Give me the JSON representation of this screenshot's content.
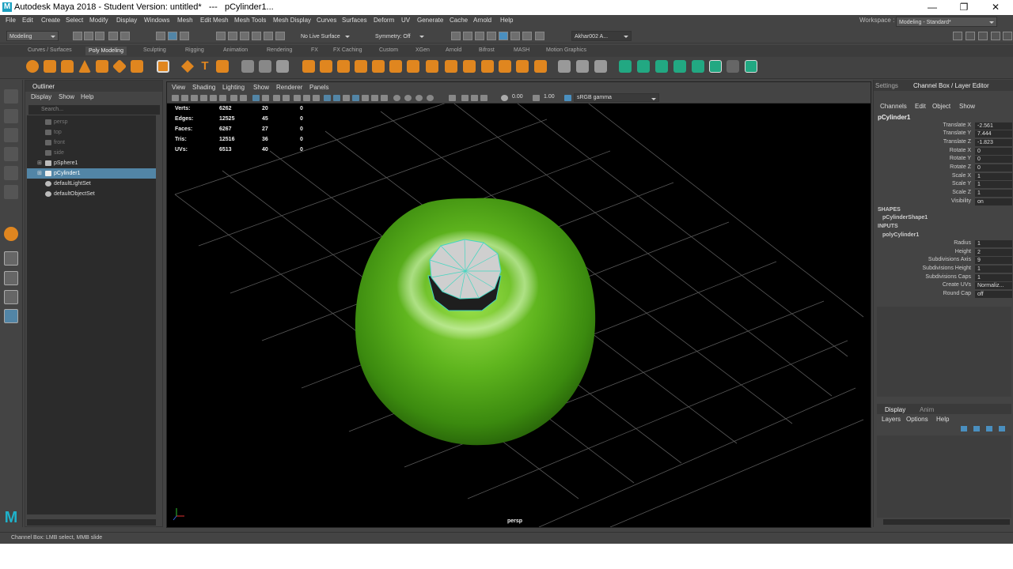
{
  "title_bar": {
    "title": "Autodesk Maya 2018 - Student Version: untitled*   ---   pCylinder1...",
    "minimize": "—",
    "maximize": "❐",
    "close": "✕"
  },
  "menu": [
    "File",
    "Edit",
    "Create",
    "Select",
    "Modify",
    "Display",
    "Windows",
    "Mesh",
    "Edit Mesh",
    "Mesh Tools",
    "Mesh Display",
    "Curves",
    "Surfaces",
    "Deform",
    "UV",
    "Generate",
    "Cache",
    "Arnold",
    "Help"
  ],
  "workspace": {
    "label": "Workspace :",
    "value": "Modeling - Standard*"
  },
  "status_line": {
    "mode": "Modeling",
    "live_surface": "No Live Surface",
    "symmetry": "Symmetry: Off",
    "user": "Akhar002 A..."
  },
  "shelf_tabs": [
    "Curves / Surfaces",
    "Poly Modeling",
    "Sculpting",
    "Rigging",
    "Animation",
    "Rendering",
    "FX",
    "FX Caching",
    "Custom",
    "XGen",
    "Arnold",
    "Bifrost",
    "MASH",
    "Motion Graphics"
  ],
  "active_shelf_tab": "Poly Modeling",
  "outliner": {
    "title": "Outliner",
    "menus": [
      "Display",
      "Show",
      "Help"
    ],
    "search_placeholder": "Search...",
    "items": [
      {
        "label": "persp",
        "dim": true
      },
      {
        "label": "top",
        "dim": true
      },
      {
        "label": "front",
        "dim": true
      },
      {
        "label": "side",
        "dim": true
      },
      {
        "label": "pSphere1",
        "dim": false
      },
      {
        "label": "pCylinder1",
        "dim": false,
        "selected": true
      },
      {
        "label": "defaultLightSet",
        "dim": false
      },
      {
        "label": "defaultObjectSet",
        "dim": false
      }
    ]
  },
  "viewport": {
    "menus": [
      "View",
      "Shading",
      "Lighting",
      "Show",
      "Renderer",
      "Panels"
    ],
    "exposure": "0.00",
    "gamma": "1.00",
    "color_space": "sRGB gamma",
    "camera": "persp",
    "hud": [
      {
        "label": "Verts:",
        "a": "6262",
        "b": "20",
        "c": "0"
      },
      {
        "label": "Edges:",
        "a": "12525",
        "b": "45",
        "c": "0"
      },
      {
        "label": "Faces:",
        "a": "6267",
        "b": "27",
        "c": "0"
      },
      {
        "label": "Tris:",
        "a": "12516",
        "b": "36",
        "c": "0"
      },
      {
        "label": "UVs:",
        "a": "6513",
        "b": "40",
        "c": "0"
      }
    ]
  },
  "channel_box": {
    "tab_settings": "Settings",
    "tab_title": "Channel Box / Layer Editor",
    "menus": [
      "Channels",
      "Edit",
      "Object",
      "Show"
    ],
    "object": "pCylinder1",
    "attributes": [
      {
        "name": "Translate X",
        "value": "-2.561"
      },
      {
        "name": "Translate Y",
        "value": "7.444"
      },
      {
        "name": "Translate Z",
        "value": "-1.823"
      },
      {
        "name": "Rotate X",
        "value": "0"
      },
      {
        "name": "Rotate Y",
        "value": "0"
      },
      {
        "name": "Rotate Z",
        "value": "0"
      },
      {
        "name": "Scale X",
        "value": "1"
      },
      {
        "name": "Scale Y",
        "value": "1"
      },
      {
        "name": "Scale Z",
        "value": "1"
      },
      {
        "name": "Visibility",
        "value": "on"
      }
    ],
    "shapes_label": "SHAPES",
    "shape_name": "pCylinderShape1",
    "inputs_label": "INPUTS",
    "input_name": "polyCylinder1",
    "inputs": [
      {
        "name": "Radius",
        "value": "1"
      },
      {
        "name": "Height",
        "value": "2"
      },
      {
        "name": "Subdivisions Axis",
        "value": "9"
      },
      {
        "name": "Subdivisions Height",
        "value": "1"
      },
      {
        "name": "Subdivisions Caps",
        "value": "1"
      },
      {
        "name": "Create UVs",
        "value": "Normaliz..."
      },
      {
        "name": "Round Cap",
        "value": "off"
      }
    ],
    "layer_tabs": [
      "Display",
      "Anim"
    ],
    "layer_menus": [
      "Layers",
      "Options",
      "Help"
    ]
  },
  "help_line": "Channel Box: LMB select, MMB slide",
  "colors": {
    "accent": "#5285a6",
    "apple": "#5fb51e",
    "cylinder": "#c8c8c8"
  }
}
